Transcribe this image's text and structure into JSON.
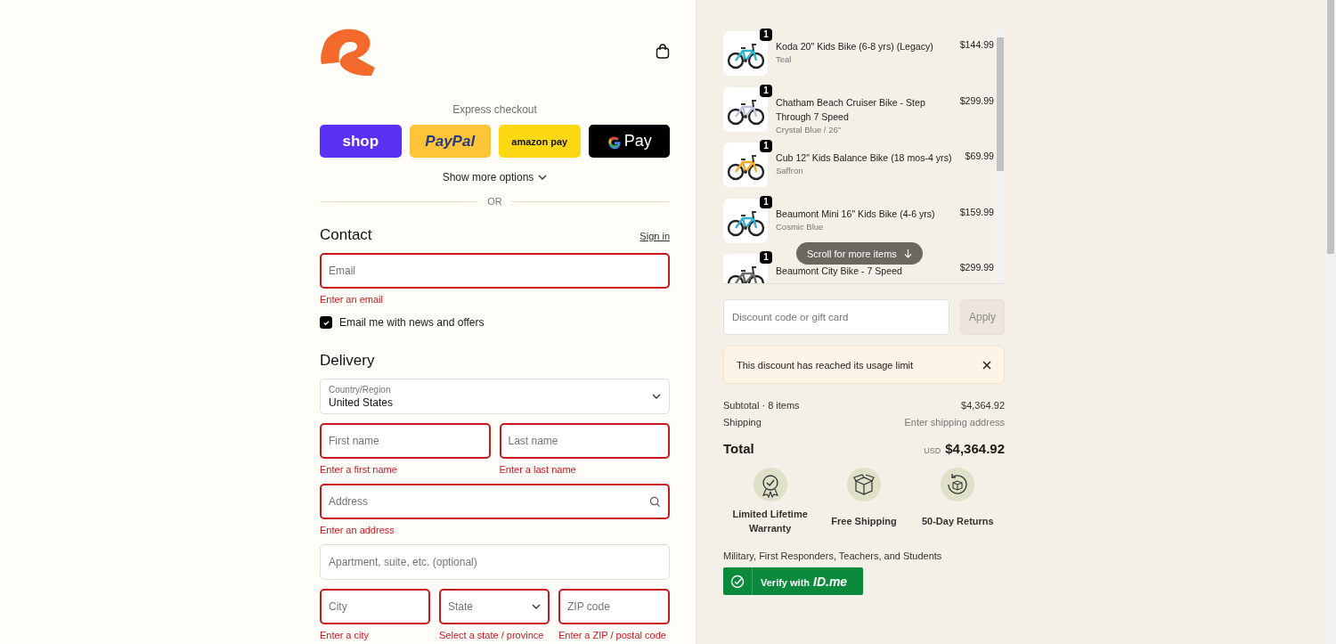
{
  "express": {
    "title": "Express checkout",
    "buttons": [
      {
        "kind": "shop",
        "label": "shop"
      },
      {
        "kind": "paypal",
        "label": "PayPal"
      },
      {
        "kind": "amazon",
        "label": "amazon pay"
      },
      {
        "kind": "gpay",
        "label": "Pay"
      }
    ],
    "more": "Show more options",
    "divider": "OR"
  },
  "contact": {
    "heading": "Contact",
    "sign_in": "Sign in",
    "email": {
      "placeholder": "Email",
      "invalid": true,
      "error": "Enter an email"
    },
    "newsletter": {
      "label": "Email me with news and offers",
      "checked": true
    }
  },
  "delivery": {
    "heading": "Delivery",
    "country": {
      "label": "Country/Region",
      "value": "United States"
    },
    "rows": [
      [
        {
          "kind": "text",
          "placeholder": "First name",
          "invalid": true,
          "error": "Enter a first name"
        },
        {
          "kind": "text",
          "placeholder": "Last name",
          "invalid": true,
          "error": "Enter a last name"
        }
      ],
      [
        {
          "kind": "search",
          "placeholder": "Address",
          "invalid": true,
          "error": "Enter an address"
        }
      ],
      [
        {
          "kind": "text",
          "placeholder": "Apartment, suite, etc. (optional)",
          "invalid": false
        }
      ],
      [
        {
          "kind": "text",
          "placeholder": "City",
          "invalid": true,
          "error": "Enter a city"
        },
        {
          "kind": "select",
          "placeholder": "State",
          "invalid": true,
          "error": "Select a state / province"
        },
        {
          "kind": "text",
          "placeholder": "ZIP code",
          "invalid": true,
          "error": "Enter a ZIP / postal code"
        }
      ]
    ]
  },
  "cart": {
    "items": [
      {
        "name": "Koda 20\" Kids Bike (6-8 yrs) (Legacy)",
        "variant": "Teal",
        "price": "$144.99",
        "quantity": "1"
      },
      {
        "name": "Chatham Beach Cruiser Bike - Step Through 7 Speed",
        "variant": "Crystal Blue / 26\"",
        "price": "$299.99",
        "quantity": "1"
      },
      {
        "name": "Cub 12\" Kids Balance Bike (18 mos-4 yrs)",
        "variant": "Saffron",
        "price": "$69.99",
        "quantity": "1"
      },
      {
        "name": "Beaumont Mini 16\" Kids Bike (4-6 yrs)",
        "variant": "Cosmic Blue",
        "price": "$159.99",
        "quantity": "1"
      },
      {
        "name": "Beaumont City Bike - 7 Speed",
        "price": "$299.99",
        "quantity": "1"
      }
    ],
    "scroll_hint": "Scroll for more items"
  },
  "discount": {
    "placeholder": "Discount code or gift card",
    "apply": "Apply",
    "apply_disabled": true,
    "notice": "This discount has reached its usage limit"
  },
  "summary": {
    "subtotal_label": "Subtotal · 8 items",
    "subtotal": "$4,364.92",
    "shipping_label": "Shipping",
    "shipping": "Enter shipping address",
    "total_label": "Total",
    "currency": "USD",
    "total": "$4,364.92"
  },
  "features": [
    {
      "kind": "warranty",
      "label": "Limited Lifetime Warranty"
    },
    {
      "kind": "shipping",
      "label": "Free Shipping"
    },
    {
      "kind": "returns",
      "label": "50-Day Returns"
    }
  ],
  "verify": {
    "text": "Military, First Responders, Teachers, and Students",
    "label": "Verify with",
    "brand": "ID.me"
  }
}
